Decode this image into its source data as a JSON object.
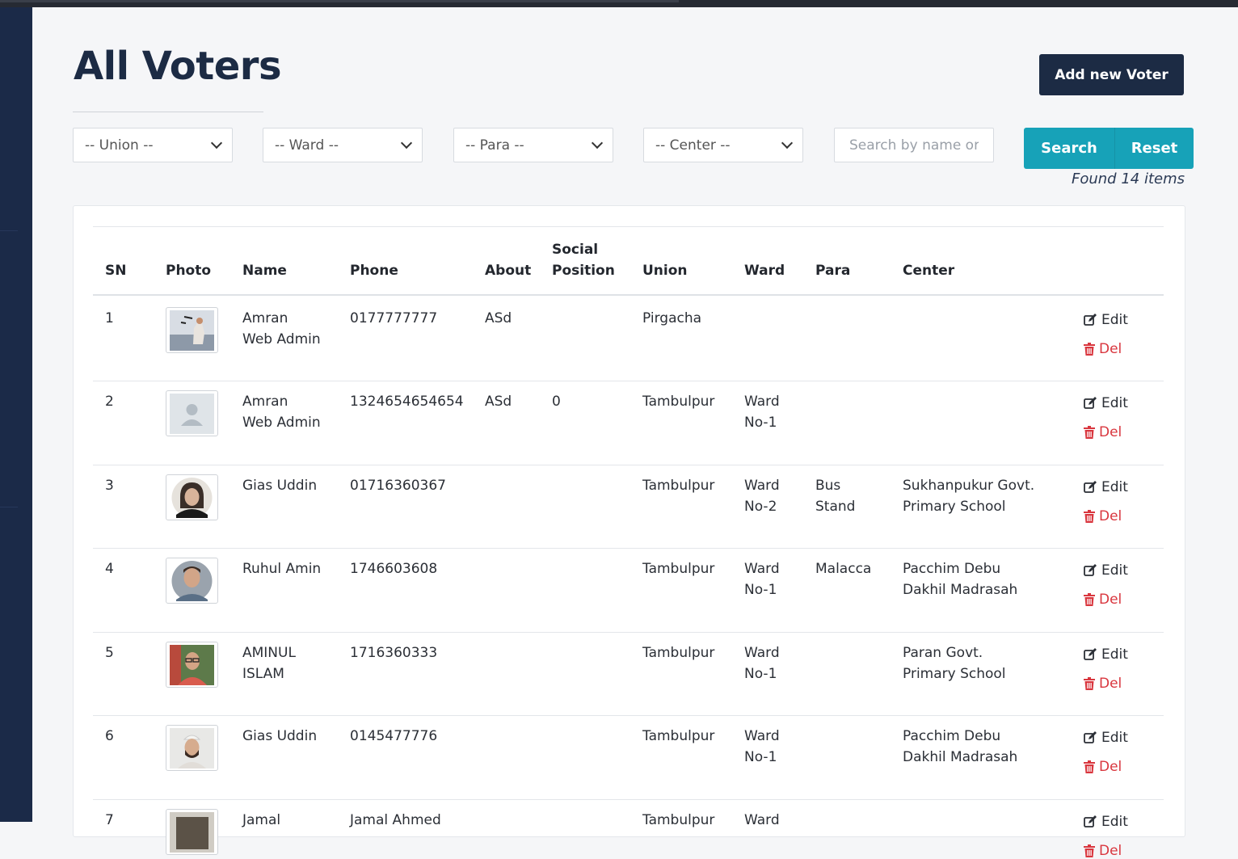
{
  "page": {
    "title": "All Voters",
    "add_button": "Add new Voter"
  },
  "filters": {
    "union": "-- Union --",
    "ward": "-- Ward --",
    "para": "-- Para --",
    "center": "-- Center --",
    "search_placeholder": "Search by name or phone",
    "search_button": "Search",
    "reset_button": "Reset",
    "found_text": "Found 14 items"
  },
  "table": {
    "headers": {
      "sn": "SN",
      "photo": "Photo",
      "name": "Name",
      "phone": "Phone",
      "about": "About",
      "social_position_1": "Social",
      "social_position_2": "Position",
      "union": "Union",
      "ward": "Ward",
      "para": "Para",
      "center": "Center"
    },
    "edit_label": "Edit",
    "del_label": "Del",
    "rows": [
      {
        "sn": "1",
        "photo": "person-waving-photo",
        "name1": "Amran",
        "name2": "Web Admin",
        "phone": "0177777777",
        "about": "ASd",
        "social": "",
        "union": "Pirgacha",
        "ward1": "",
        "ward2": "",
        "para1": "",
        "para2": "",
        "center1": "",
        "center2": ""
      },
      {
        "sn": "2",
        "photo": "placeholder-avatar",
        "name1": "Amran",
        "name2": "Web Admin",
        "phone": "1324654654654",
        "about": "ASd",
        "social": "0",
        "union": "Tambulpur",
        "ward1": "Ward",
        "ward2": "No-1",
        "para1": "",
        "para2": "",
        "center1": "",
        "center2": ""
      },
      {
        "sn": "3",
        "photo": "woman-portrait-photo",
        "name1": "Gias Uddin",
        "name2": "",
        "phone": "01716360367",
        "about": "",
        "social": "",
        "union": "Tambulpur",
        "ward1": "Ward",
        "ward2": "No-2",
        "para1": "Bus",
        "para2": "Stand",
        "center1": "Sukhanpukur Govt.",
        "center2": "Primary School"
      },
      {
        "sn": "4",
        "photo": "man-portrait-photo",
        "name1": "Ruhul Amin",
        "name2": "",
        "phone": "1746603608",
        "about": "",
        "social": "",
        "union": "Tambulpur",
        "ward1": "Ward",
        "ward2": "No-1",
        "para1": "Malacca",
        "para2": "",
        "center1": "Pacchim Debu",
        "center2": "Dakhil Madrasah"
      },
      {
        "sn": "5",
        "photo": "man-glasses-photo",
        "name1": "AMINUL",
        "name2": "ISLAM",
        "phone": "1716360333",
        "about": "",
        "social": "",
        "union": "Tambulpur",
        "ward1": "Ward",
        "ward2": "No-1",
        "para1": "",
        "para2": "",
        "center1": "Paran Govt.",
        "center2": "Primary School"
      },
      {
        "sn": "6",
        "photo": "man-cap-photo",
        "name1": "Gias Uddin",
        "name2": "",
        "phone": "0145477776",
        "about": "",
        "social": "",
        "union": "Tambulpur",
        "ward1": "Ward",
        "ward2": "No-1",
        "para1": "",
        "para2": "",
        "center1": "Pacchim Debu",
        "center2": "Dakhil Madrasah"
      },
      {
        "sn": "7",
        "photo": "partial-photo",
        "name1": "Jamal",
        "name2": "",
        "phone": "Jamal Ahmed",
        "about": "",
        "social": "",
        "union": "Tambulpur",
        "ward1": "Ward",
        "ward2": "",
        "para1": "",
        "para2": "",
        "center1": "",
        "center2": ""
      }
    ]
  }
}
